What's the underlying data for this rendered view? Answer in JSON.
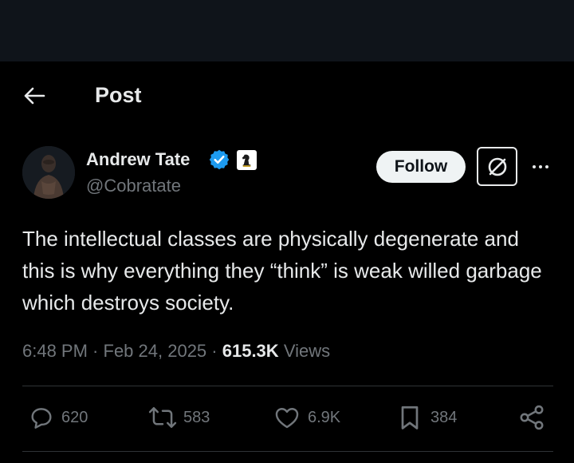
{
  "header": {
    "title": "Post",
    "back_icon": "arrow-left-icon"
  },
  "author": {
    "name": "Andrew Tate",
    "handle": "@Cobratate",
    "verified_color": "#1d9bf0",
    "affiliation_icon": "chess-knight-icon"
  },
  "actions_top": {
    "follow_label": "Follow",
    "grok_icon": "grok-icon",
    "more_icon": "more-dots-icon"
  },
  "tweet": {
    "text": "The intellectual classes are physically degenerate and this is why everything they “think” is weak willed garbage which destroys society.",
    "time": "6:48 PM",
    "sep1": " · ",
    "date": "Feb 24, 2025",
    "sep2": " · ",
    "views_count": "615.3K",
    "views_label": "Views"
  },
  "engagement": {
    "replies": "620",
    "reposts": "583",
    "likes": "6.9K",
    "bookmarks": "384"
  },
  "colors": {
    "background": "#000000",
    "top_strip": "#0f141a",
    "text_primary": "#e7e9ea",
    "text_secondary": "#71767b",
    "divider": "#2f3336",
    "follow_bg": "#eff3f4"
  }
}
